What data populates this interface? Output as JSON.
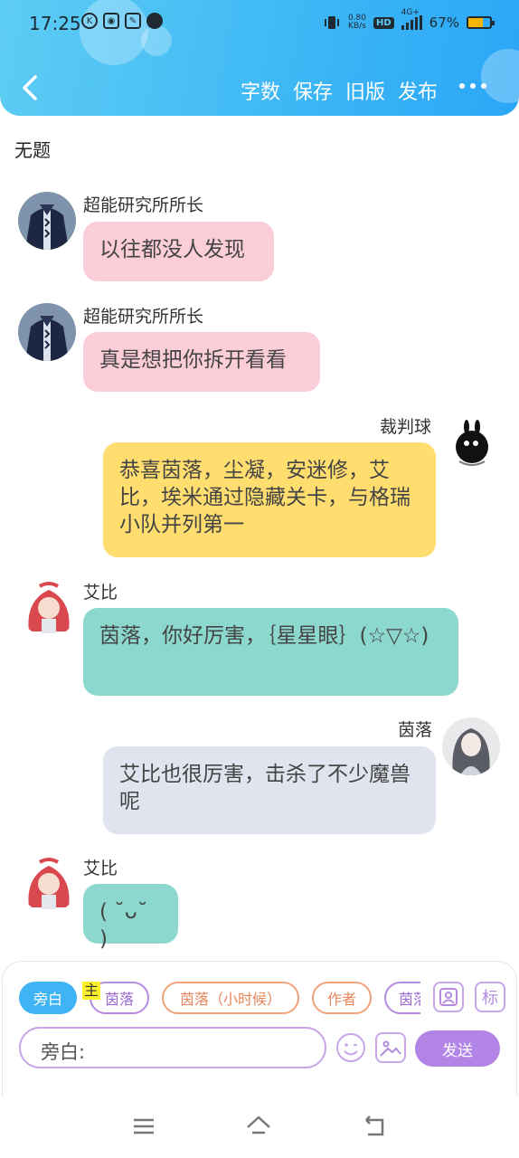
{
  "status_bar": {
    "time": "17:25",
    "net_speed_value": "0.80",
    "net_speed_unit": "KB/s",
    "hd": "HD",
    "network": "4G+",
    "battery": "67%",
    "battery_level": 0.67
  },
  "header": {
    "actions": [
      "字数",
      "保存",
      "旧版",
      "发布"
    ]
  },
  "doc_title": "无题",
  "messages": [
    {
      "name": "超能研究所所长",
      "text": "以往都没人发现"
    },
    {
      "name": "超能研究所所长",
      "text": "真是想把你拆开看看"
    },
    {
      "name": "裁判球",
      "text": "恭喜茵落，尘凝，安迷修，艾比，埃米通过隐藏关卡，与格瑞小队并列第一"
    },
    {
      "name": "艾比",
      "text": "茵落，你好厉害，｛星星眼｝(☆▽☆)"
    },
    {
      "name": "茵落",
      "text": "艾比也很厉害，击杀了不少魔兽呢"
    },
    {
      "name": "艾比",
      "text": "( ˘ᴗ˘ )"
    }
  ],
  "panel": {
    "roles": [
      "旁白",
      "茵落",
      "茵落（小时候）",
      "作者",
      "茵落"
    ],
    "role_tag": "主",
    "mark_button": "标",
    "input_value": "旁白:",
    "send_label": "发送"
  },
  "colors": {
    "header_accent": "#3fb8f5",
    "pink_bubble": "#fbcdd8",
    "yellow_bubble": "#ffdd6f",
    "teal_bubble": "#8cd8cf",
    "grey_bubble": "#dfe4ee",
    "send_button": "#b184e6"
  }
}
